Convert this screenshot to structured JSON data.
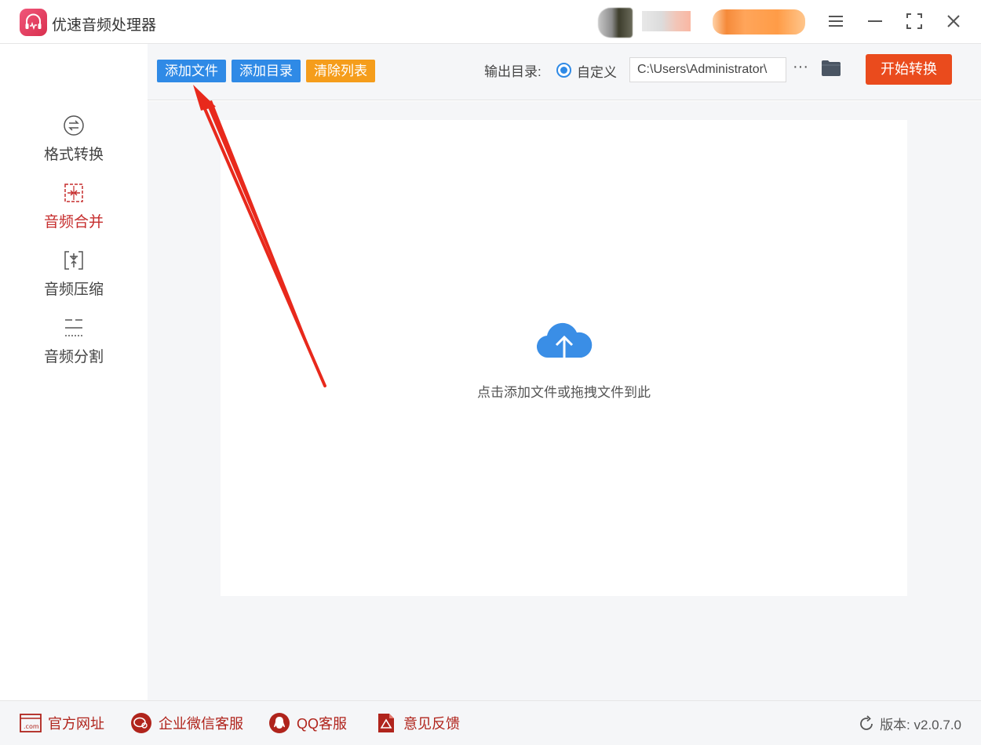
{
  "app": {
    "title": "优速音频处理器"
  },
  "window_controls": {
    "menu_icon": "menu-icon",
    "minimize_icon": "minimize-icon",
    "maximize_icon": "maximize-icon",
    "close_icon": "close-icon"
  },
  "sidebar": {
    "items": [
      {
        "label": "格式转换",
        "icon": "format-convert-icon",
        "active": false
      },
      {
        "label": "音频合并",
        "icon": "audio-merge-icon",
        "active": true
      },
      {
        "label": "音频压缩",
        "icon": "audio-compress-icon",
        "active": false
      },
      {
        "label": "音频分割",
        "icon": "audio-split-icon",
        "active": false
      }
    ]
  },
  "toolbar": {
    "add_file": "添加文件",
    "add_folder": "添加目录",
    "clear_list": "清除列表",
    "output_label": "输出目录:",
    "radio_custom": "自定义",
    "output_path": "C:\\Users\\Administrator\\",
    "more": "···",
    "start": "开始转换"
  },
  "dropzone": {
    "hint": "点击添加文件或拖拽文件到此"
  },
  "footer": {
    "website": "官方网址",
    "wechat": "企业微信客服",
    "qq": "QQ客服",
    "feedback": "意见反馈",
    "version": "版本:  v2.0.7.0"
  },
  "colors": {
    "accent_blue": "#2f8ae6",
    "accent_orange": "#f59d1b",
    "start_red": "#ea4b1d",
    "active_red": "#c62d2d",
    "annotation_arrow": "#e8291c"
  }
}
